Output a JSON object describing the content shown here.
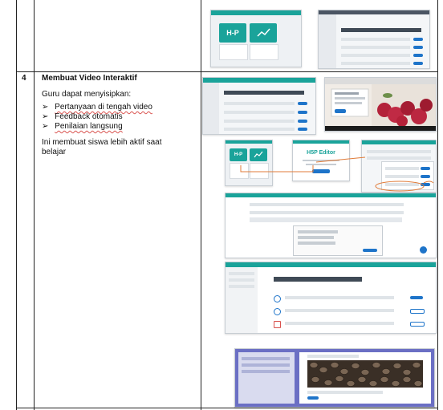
{
  "table": {
    "row_number": "4",
    "title": "Membuat Video Interaktif",
    "intro": "Guru dapat menyisipkan:",
    "bullets": [
      "Pertanyaan di tengah video",
      "Feedback otomatis",
      "Penilaian langsung"
    ],
    "summary_lines": [
      "Ini membuat siswa lebih aktif saat",
      "belajar"
    ]
  },
  "screenshots": {
    "hp_tile_label": "H-P",
    "hp_editor_title": "H5P Editor"
  },
  "colors": {
    "accent_teal": "#1aa39a",
    "link_blue": "#1e74c9",
    "annotation_orange": "#e07b39"
  }
}
